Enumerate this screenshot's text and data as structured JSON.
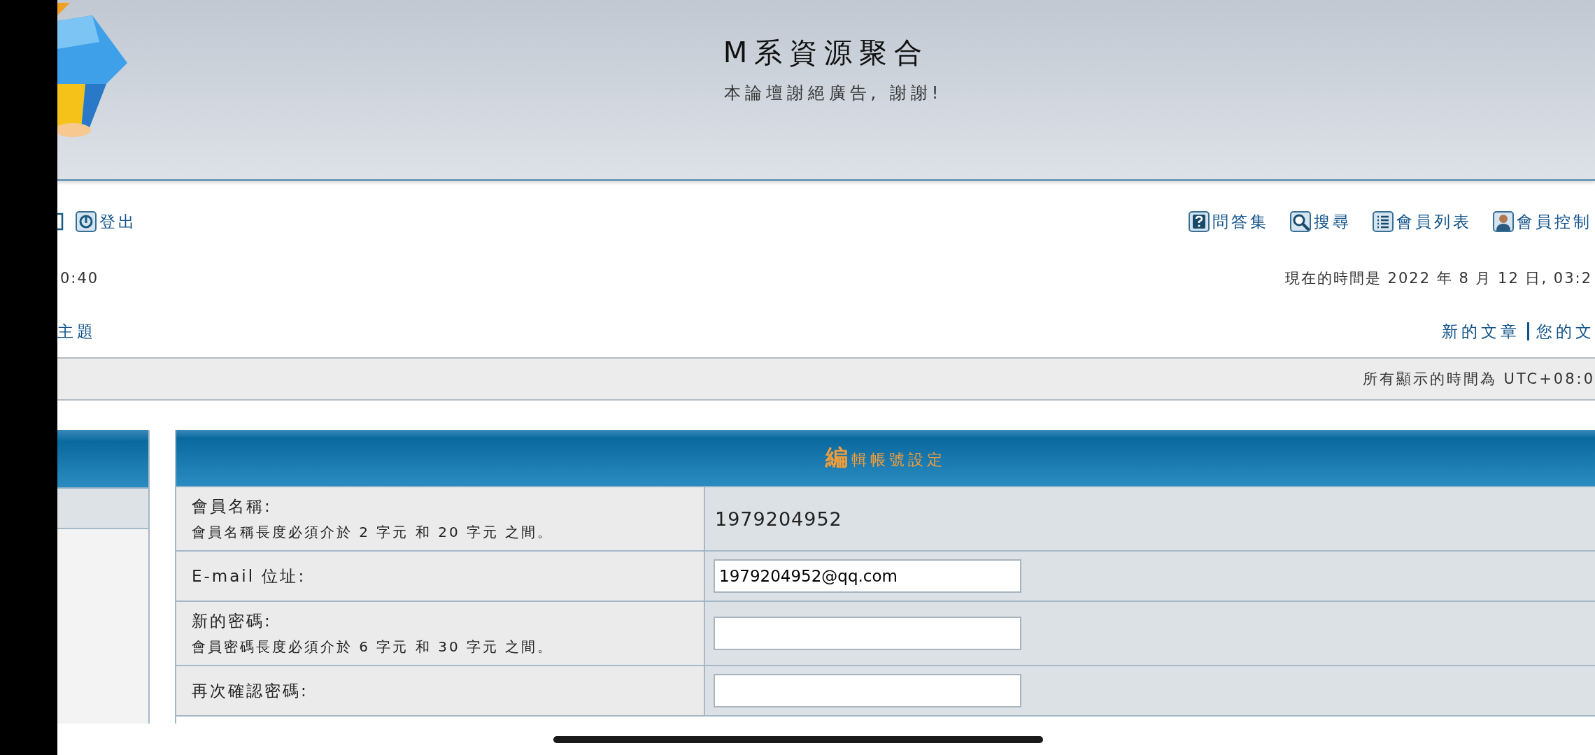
{
  "header": {
    "title": "M系資源聚合",
    "subtitle": "本論壇謝絕廣告, 謝謝!"
  },
  "nav_left": [
    {
      "label": "登出",
      "kind": "logout"
    }
  ],
  "nav_right": [
    {
      "label": "問答集",
      "kind": "help"
    },
    {
      "label": "搜尋",
      "kind": "search"
    },
    {
      "label": "會員列表",
      "kind": "list"
    },
    {
      "label": "會員控制",
      "kind": "user"
    }
  ],
  "last_visit": "0:40",
  "current_time": "現在的時間是 2022 年 8 月 12 日, 03:2",
  "links_left": [
    "主題"
  ],
  "links_right": [
    "新的文章",
    "您的文"
  ],
  "timezone": "所有顯示的時間為 UTC+08:0",
  "form": {
    "title": "編輯帳號設定",
    "rows": [
      {
        "label": "會員名稱:",
        "hint": "會員名稱長度必須介於 2 字元 和 20 字元 之間。",
        "kind": "text",
        "value": "1979204952"
      },
      {
        "label": "E-mail 位址:",
        "kind": "input",
        "value": "1979204952@qq.com"
      },
      {
        "label": "新的密碼:",
        "hint": "會員密碼長度必須介於 6 字元 和 30 字元 之間。",
        "kind": "input"
      },
      {
        "label": "再次確認密碼:",
        "kind": "input"
      }
    ]
  }
}
